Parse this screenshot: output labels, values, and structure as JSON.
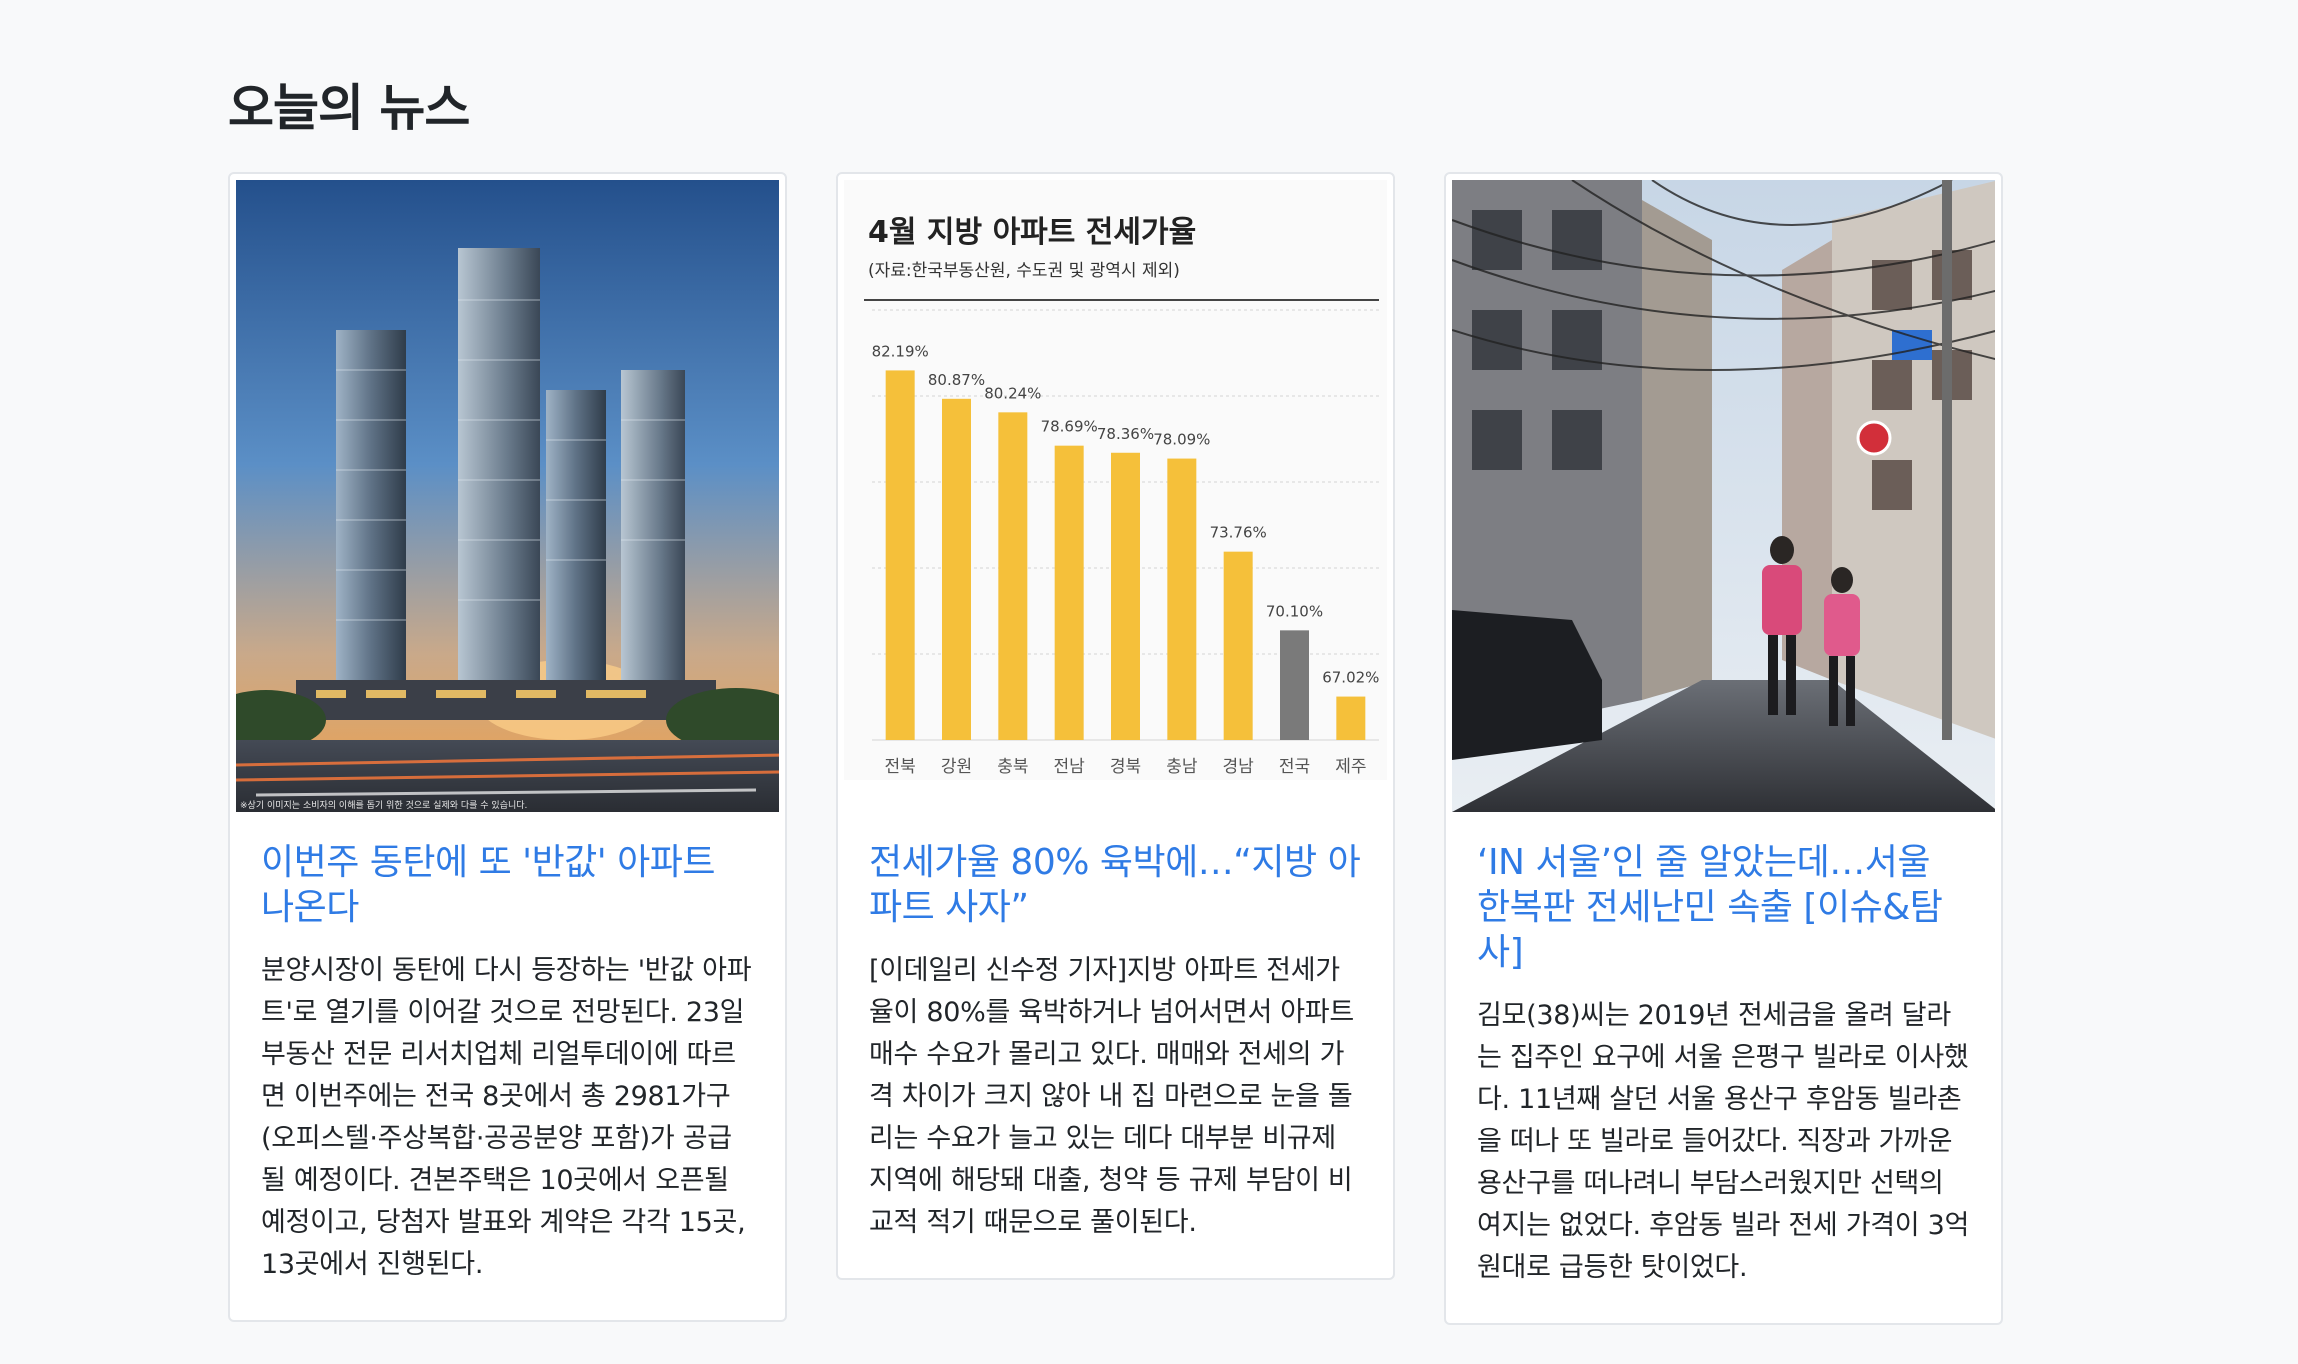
{
  "page": {
    "title": "오늘의 뉴스"
  },
  "articles": [
    {
      "title": "이번주 동탄에 또 '반값' 아파트 나온다",
      "body": "분양시장이 동탄에 다시 등장하는 '반값 아파트'로 열기를 이어갈 것으로 전망된다. 23일 부동산 전문 리서치업체 리얼투데이에 따르면 이번주에는 전국 8곳에서 총 2981가구(오피스텔·주상복합·공공분양 포함)가 공급될 예정이다. 견본주택은 10곳에서 오픈될 예정이고, 당첨자 발표와 계약은 각각 15곳, 13곳에서 진행된다.",
      "image": {
        "caption": "※상기 이미지는 소비자의 이해를 돕기 위한 것으로 실제와 다를 수 있습니다."
      }
    },
    {
      "title": "전세가율 80% 육박에…“지방 아파트 사자”",
      "body": "[이데일리 신수정 기자]지방 아파트 전세가율이 80%를 육박하거나 넘어서면서 아파트 매수 수요가 몰리고 있다. 매매와 전세의 가격 차이가 크지 않아 내 집 마련으로 눈을 돌리는 수요가 늘고 있는 데다 대부분 비규제 지역에 해당돼 대출, 청약 등 규제 부담이 비교적 적기 때문으로 풀이된다."
    },
    {
      "title": "‘IN 서울’인 줄 알았는데…서울 한복판 전세난민 속출 [이슈&탐사]",
      "body": "김모(38)씨는 2019년 전세금을 올려 달라는 집주인 요구에 서울 은평구 빌라로 이사했다. 11년째 살던 서울 용산구 후암동 빌라촌을 떠나 또 빌라로 들어갔다. 직장과 가까운 용산구를 떠나려니 부담스러웠지만 선택의 여지는 없었다. 후암동 빌라 전세 가격이 3억원대로 급등한 탓이었다."
    }
  ],
  "chart_data": {
    "type": "bar",
    "title": "4월 지방 아파트 전세가율",
    "subtitle": "(자료:한국부동산원, 수도권 및 광역시 제외)",
    "categories": [
      "전북",
      "강원",
      "충북",
      "전남",
      "경북",
      "충남",
      "경남",
      "전국",
      "제주"
    ],
    "values": [
      82.19,
      80.87,
      80.24,
      78.69,
      78.36,
      78.09,
      73.76,
      70.1,
      67.02
    ],
    "labels": [
      "82.19%",
      "80.87%",
      "80.24%",
      "78.69%",
      "78.36%",
      "78.09%",
      "73.76%",
      "70.10%",
      "67.02%"
    ],
    "ylim": [
      65,
      85
    ],
    "grid": true,
    "colors": {
      "bar": "#f5c03a",
      "highlight": "#7a7a7a"
    },
    "highlight_category": "전국"
  }
}
